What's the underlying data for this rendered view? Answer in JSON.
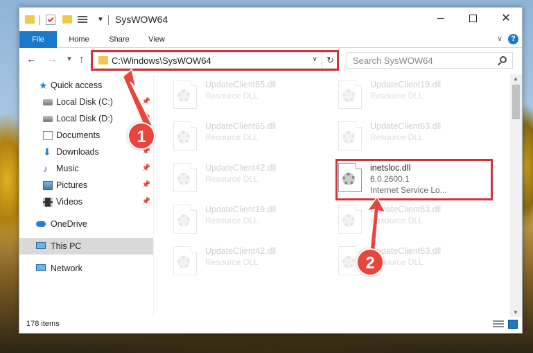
{
  "window": {
    "title": "SysWOW64"
  },
  "ribbon": {
    "tabs": [
      "File",
      "Home",
      "Share",
      "View"
    ]
  },
  "navbar": {
    "address": "C:\\Windows\\SysWOW64",
    "search_placeholder": "Search SysWOW64"
  },
  "sidebar": {
    "items": [
      {
        "label": "Quick access",
        "icon": "star-icon",
        "pinned": false
      },
      {
        "label": "Local Disk (C:)",
        "icon": "drive-icon",
        "pinned": true
      },
      {
        "label": "Local Disk (D:)",
        "icon": "drive-icon",
        "pinned": true
      },
      {
        "label": "Documents",
        "icon": "documents-icon",
        "pinned": true
      },
      {
        "label": "Downloads",
        "icon": "download-icon",
        "pinned": true
      },
      {
        "label": "Music",
        "icon": "music-icon",
        "pinned": true
      },
      {
        "label": "Pictures",
        "icon": "pictures-icon",
        "pinned": true
      },
      {
        "label": "Videos",
        "icon": "videos-icon",
        "pinned": true
      },
      {
        "label": "OneDrive",
        "icon": "onedrive-icon",
        "pinned": false
      },
      {
        "label": "This PC",
        "icon": "this-pc-icon",
        "pinned": false,
        "selected": true
      },
      {
        "label": "Network",
        "icon": "network-icon",
        "pinned": false
      }
    ]
  },
  "files": [
    {
      "name": "UpdateClient65.dll",
      "line1": "Resource DLL",
      "line2": "",
      "faded": true
    },
    {
      "name": "UpdateClient19.dll",
      "line1": "Resource DLL",
      "line2": "",
      "faded": true
    },
    {
      "name": "UpdateClient65.dll",
      "line1": "Resource DLL",
      "line2": "",
      "faded": true
    },
    {
      "name": "UpdateClient63.dll",
      "line1": "Resource DLL",
      "line2": "",
      "faded": true
    },
    {
      "name": "UpdateClient42.dll",
      "line1": "Resource DLL",
      "line2": "",
      "faded": true
    },
    {
      "name": "inetsloc.dll",
      "line1": "6.0.2600.1",
      "line2": "Internet Service Lo...",
      "faded": false
    },
    {
      "name": "UpdateClient19.dll",
      "line1": "Resource DLL",
      "line2": "",
      "faded": true
    },
    {
      "name": "UpdateClient63.dll",
      "line1": "Resource DLL",
      "line2": "",
      "faded": true
    },
    {
      "name": "UpdateClient42.dll",
      "line1": "Resource DLL",
      "line2": "",
      "faded": true
    },
    {
      "name": "UpdateClient63.dll",
      "line1": "Resource DLL",
      "line2": "",
      "faded": true
    }
  ],
  "status": {
    "item_count": "178 items"
  },
  "annotations": {
    "badge_1": "1",
    "badge_2": "2",
    "highlight_color": "#d13438",
    "arrow_color": "#e8453c"
  },
  "colors": {
    "accent": "#1979ca",
    "selection": "#d9d9d9"
  }
}
